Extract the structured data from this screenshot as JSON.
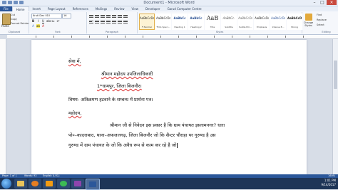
{
  "window": {
    "title": "Document1 - Microsoft Word"
  },
  "tabs": [
    "File",
    "Home",
    "Insert",
    "Page Layout",
    "References",
    "Mailings",
    "Review",
    "View",
    "Developer",
    "Garud Computer Centre"
  ],
  "ribbon": {
    "clipboard": {
      "paste": "Paste",
      "cut": "Cut",
      "copy": "Copy",
      "format_painter": "Format Painter",
      "label": "Clipboard"
    },
    "font": {
      "name": "Kruti Dev 010",
      "size": "16",
      "label": "Font"
    },
    "paragraph": {
      "label": "Paragraph"
    },
    "styles": {
      "label": "Styles",
      "tiles": [
        {
          "sample": "AaBbCcDc",
          "name": "¶ Normal"
        },
        {
          "sample": "AaBbCcDc",
          "name": "¶ No Spaci..."
        },
        {
          "sample": "AaBbCc",
          "name": "Heading 1"
        },
        {
          "sample": "AaBbCc",
          "name": "Heading 2"
        },
        {
          "sample": "AaB",
          "name": "Title"
        },
        {
          "sample": "AaBbCc.",
          "name": "Subtitle"
        },
        {
          "sample": "AaBbCcDc",
          "name": "Subtle Em..."
        },
        {
          "sample": "AaBbCcDc",
          "name": "Emphasis"
        },
        {
          "sample": "AaBbCcDc",
          "name": "Intense E..."
        },
        {
          "sample": "AaBbCcDc",
          "name": "Strong"
        }
      ],
      "change_styles": "Change Styles"
    },
    "editing": {
      "find": "Find",
      "replace": "Replace",
      "select": "Select",
      "label": "Editing"
    }
  },
  "document": {
    "lines": [
      "सेवा में,",
      "श्रीमान महोदय उपजिलाधिकारी",
      "1*धामपुर, जिला बिजनौर।",
      "विषय-        अतिक्रमण हटवाने के सम्बन्ध में प्रार्थना पत्र।",
      "महोदय,",
      "श्रीमान जी से निवेदन इस प्रकार है कि ग्राम पंचायत इस्लामनगर? धारा",
      "पो०–कादराबाद, थाना–अफजलगढ़, जिला बिजनौर जो कि सैन्टर चौराहा पर गुरुण्ड है उस",
      "गुरुण्ड में ग्राम पंचायत के जो कि अवैध रूप से काम कर रहे है जो"
    ]
  },
  "statusbar": {
    "page": "Page: 1 of 1",
    "words": "Words: 92",
    "language": "English (U.S.)",
    "zoom": "160%"
  },
  "taskbar": {
    "time": "1:01 PM",
    "date": "9/14/2017"
  }
}
